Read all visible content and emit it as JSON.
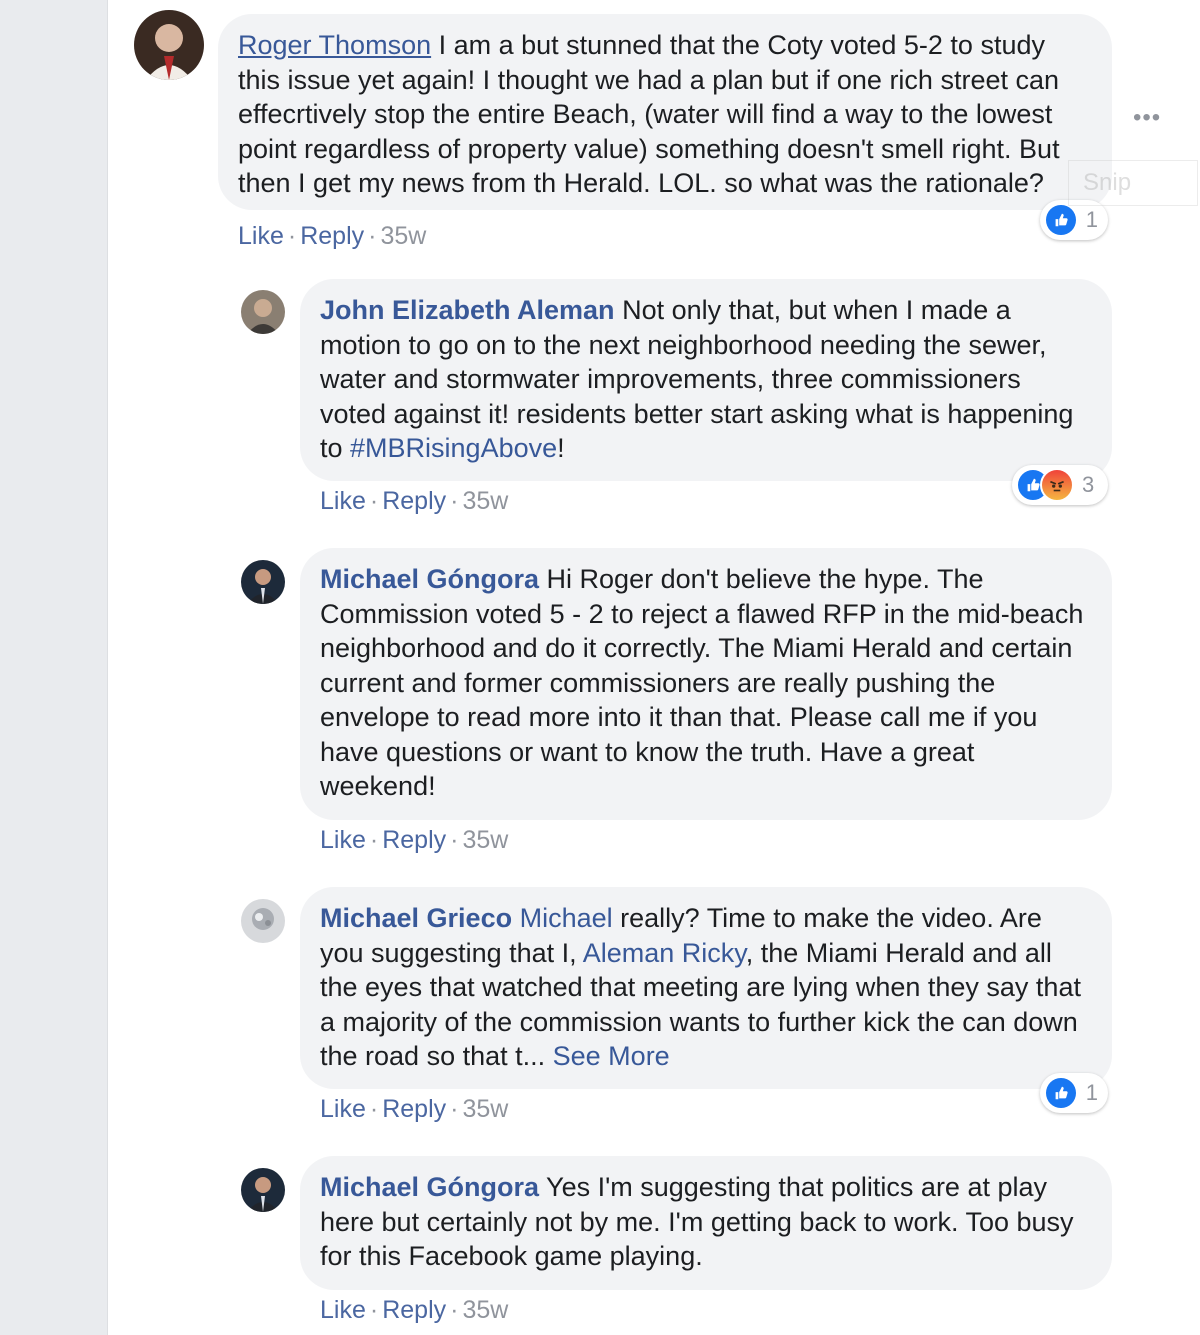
{
  "comments": [
    {
      "author": "Roger Thomson",
      "text": " I am a but stunned that the Coty voted 5-2 to study this issue yet again! I thought we had a plan but if one rich street can effecrtively stop the entire Beach, (water will find a way to the lowest point regardless of property value) something doesn't smell right. But then I get my news from th Herald. LOL. so what was the rationale?",
      "like_label": "Like",
      "reply_label": "Reply",
      "time": "35w",
      "reaction_count": "1"
    },
    {
      "author": "John Elizabeth Aleman",
      "text_before": " Not only that, but when I made a motion to go on to the next neighborhood needing the sewer, water and stormwater improvements, three commissioners voted against it! residents better start asking what is happening to ",
      "hashtag": "#MBRisingAbove",
      "text_after": "!",
      "like_label": "Like",
      "reply_label": "Reply",
      "time": "35w",
      "reaction_count": "3"
    },
    {
      "author": "Michael Góngora",
      "text": " Hi Roger don't believe the hype. The Commission voted 5 - 2 to reject a flawed RFP in the mid-beach neighborhood and do it correctly. The Miami Herald and certain current and former commissioners are really pushing the envelope to read more into it than that. Please call me if you have questions or want to know the truth. Have a great weekend!",
      "like_label": "Like",
      "reply_label": "Reply",
      "time": "35w"
    },
    {
      "author": "Michael Grieco",
      "mention1": "Michael",
      "text1": " really? Time to make the video. Are you suggesting that I, ",
      "mention2": "Aleman Ricky",
      "text2": ", the Miami Herald and all the eyes that watched that meeting are lying when they say that a majority of the commission wants to further kick the can down the road so that t... ",
      "see_more": "See More",
      "like_label": "Like",
      "reply_label": "Reply",
      "time": "35w",
      "reaction_count": "1"
    },
    {
      "author": "Michael Góngora",
      "text": " Yes I'm suggesting that politics are at play here but certainly not by me. I'm getting back to work. Too busy for this Facebook game playing.",
      "like_label": "Like",
      "reply_label": "Reply",
      "time": "35w"
    }
  ],
  "more_options": "•••",
  "snip_overlay": "Snip",
  "separator": "·",
  "colors": {
    "link": "#385898",
    "bubble": "#f2f3f5",
    "like_blue": "#1877f2"
  }
}
